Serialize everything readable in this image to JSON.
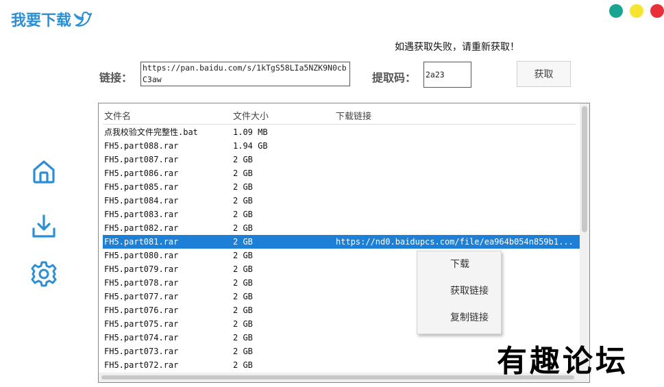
{
  "header": {
    "title": "我要下载",
    "dots": [
      "#1aa592",
      "#f5e532",
      "#e8303a"
    ],
    "accent": "#2a8fd4"
  },
  "hint": "如遇获取失败，请重新获取！",
  "form": {
    "link_label": "链接：",
    "link_value": "https://pan.baidu.com/s/1kTgS58LIa5NZK9N0cbC3aw",
    "code_label": "提取码：",
    "code_value": "2a23",
    "fetch_label": "获取"
  },
  "sidebar": {
    "icons": [
      "home-icon",
      "download-icon",
      "gear-icon"
    ]
  },
  "list": {
    "columns": [
      "文件名",
      "文件大小",
      "下载链接"
    ],
    "selected_color": "#1e7fd6",
    "rows": [
      {
        "name": "点我校验文件完整性.bat",
        "size": "1.09 MB",
        "link": ""
      },
      {
        "name": "FH5.part088.rar",
        "size": "1.94 GB",
        "link": ""
      },
      {
        "name": "FH5.part087.rar",
        "size": "2 GB",
        "link": ""
      },
      {
        "name": "FH5.part086.rar",
        "size": "2 GB",
        "link": ""
      },
      {
        "name": "FH5.part085.rar",
        "size": "2 GB",
        "link": ""
      },
      {
        "name": "FH5.part084.rar",
        "size": "2 GB",
        "link": ""
      },
      {
        "name": "FH5.part083.rar",
        "size": "2 GB",
        "link": ""
      },
      {
        "name": "FH5.part082.rar",
        "size": "2 GB",
        "link": ""
      },
      {
        "name": "FH5.part081.rar",
        "size": "2 GB",
        "link": "https://nd0.baidupcs.com/file/ea964b054n859b1..."
      },
      {
        "name": "FH5.part080.rar",
        "size": "2 GB",
        "link": ""
      },
      {
        "name": "FH5.part079.rar",
        "size": "2 GB",
        "link": ""
      },
      {
        "name": "FH5.part078.rar",
        "size": "2 GB",
        "link": ""
      },
      {
        "name": "FH5.part077.rar",
        "size": "2 GB",
        "link": ""
      },
      {
        "name": "FH5.part076.rar",
        "size": "2 GB",
        "link": ""
      },
      {
        "name": "FH5.part075.rar",
        "size": "2 GB",
        "link": ""
      },
      {
        "name": "FH5.part074.rar",
        "size": "2 GB",
        "link": ""
      },
      {
        "name": "FH5.part073.rar",
        "size": "2 GB",
        "link": ""
      },
      {
        "name": "FH5.part072.rar",
        "size": "2 GB",
        "link": ""
      }
    ]
  },
  "context_menu": {
    "items": [
      "下载",
      "获取链接",
      "复制链接"
    ]
  },
  "watermark": "有趣论坛"
}
